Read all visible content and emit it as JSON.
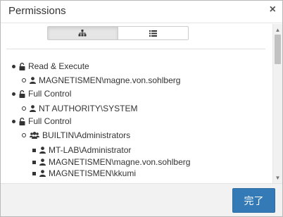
{
  "dialog": {
    "title": "Permissions",
    "close_label": "×",
    "ok_label": "完了"
  },
  "view_toggle": {
    "options": [
      {
        "icon": "hierarchy-icon",
        "active": true
      },
      {
        "icon": "list-icon",
        "active": false
      }
    ]
  },
  "tree": [
    {
      "level": 0,
      "bullet": "disc",
      "icon": "unlock-icon",
      "label": "Read & Execute"
    },
    {
      "level": 1,
      "bullet": "circle",
      "icon": "user-icon",
      "label": "MAGNETISMEN\\magne.von.sohlberg"
    },
    {
      "level": 0,
      "bullet": "disc",
      "icon": "unlock-icon",
      "label": "Full Control"
    },
    {
      "level": 1,
      "bullet": "circle",
      "icon": "user-icon",
      "label": "NT AUTHORITY\\SYSTEM"
    },
    {
      "level": 0,
      "bullet": "disc",
      "icon": "unlock-icon",
      "label": "Full Control"
    },
    {
      "level": 1,
      "bullet": "circle",
      "icon": "group-icon",
      "label": "BUILTIN\\Administrators"
    },
    {
      "level": 2,
      "bullet": "square",
      "icon": "user-icon",
      "label": "MT-LAB\\Administrator"
    },
    {
      "level": 2,
      "bullet": "square",
      "icon": "user-icon",
      "label": "MAGNETISMEN\\magne.von.sohlberg"
    },
    {
      "level": 2,
      "bullet": "square",
      "icon": "user-icon",
      "label": "MAGNETISMEN\\kkumi"
    }
  ],
  "colors": {
    "primary_button": "#337ab7",
    "text": "#333333"
  }
}
